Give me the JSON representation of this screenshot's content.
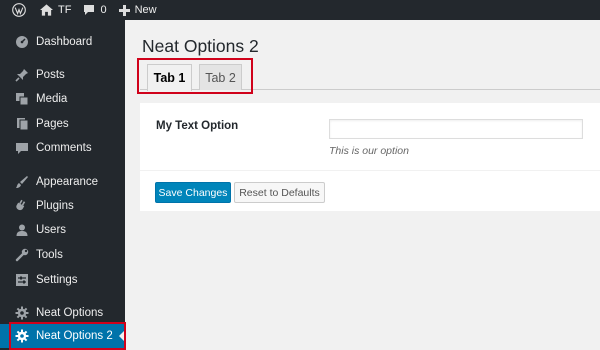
{
  "admin_bar": {
    "site_name": "TF",
    "comments_count": "0",
    "new_label": "New",
    "icons": [
      "wordpress-logo-icon",
      "home-icon",
      "comment-icon",
      "plus-icon"
    ]
  },
  "sidebar": {
    "items": [
      {
        "label": "Dashboard",
        "icon": "dashboard-icon"
      },
      {
        "label": "Posts",
        "icon": "pin-icon"
      },
      {
        "label": "Media",
        "icon": "media-icon"
      },
      {
        "label": "Pages",
        "icon": "pages-icon"
      },
      {
        "label": "Comments",
        "icon": "comments-icon"
      },
      {
        "label": "Appearance",
        "icon": "brush-icon"
      },
      {
        "label": "Plugins",
        "icon": "plug-icon"
      },
      {
        "label": "Users",
        "icon": "user-icon"
      },
      {
        "label": "Tools",
        "icon": "wrench-icon"
      },
      {
        "label": "Settings",
        "icon": "settings-icon"
      },
      {
        "label": "Neat Options",
        "icon": "gear-icon"
      },
      {
        "label": "Neat Options 2",
        "icon": "gear-icon",
        "current": true
      }
    ]
  },
  "main": {
    "title": "Neat Options 2",
    "tabs": [
      {
        "label": "Tab 1",
        "active": true
      },
      {
        "label": "Tab 2",
        "active": false
      }
    ],
    "field": {
      "label": "My Text Option",
      "value": "",
      "description": "This is our option"
    },
    "buttons": {
      "save": "Save Changes",
      "reset": "Reset to Defaults"
    }
  },
  "colors": {
    "admin_dark": "#23282d",
    "accent_blue": "#0073aa",
    "primary_button": "#0085ba",
    "highlight_red": "#d0021b",
    "background": "#f1f1f1"
  }
}
